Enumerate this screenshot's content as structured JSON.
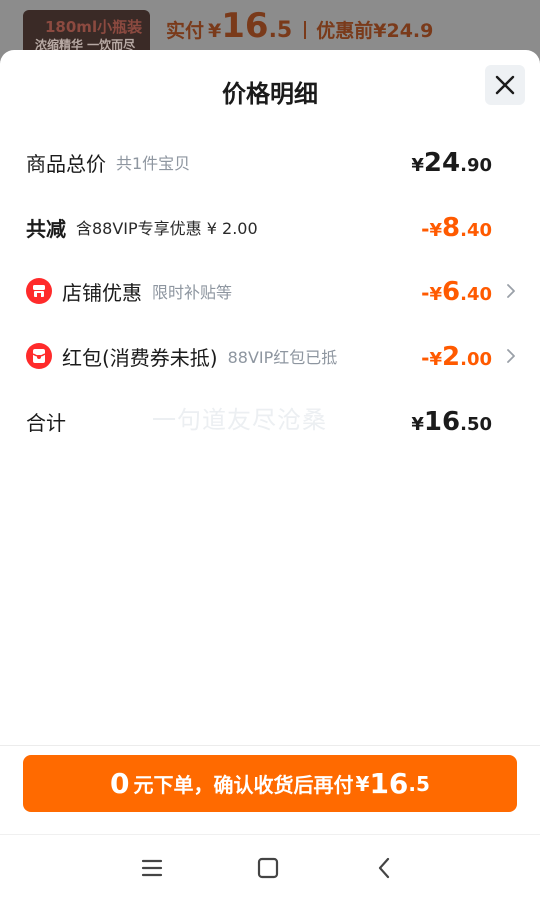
{
  "background": {
    "thumb_line1": "180ml小瓶装",
    "thumb_line2": "浓缩精华 一饮而尽",
    "paid_label": "实付",
    "paid_currency": "¥",
    "paid_int": "16",
    "paid_dec": ".5",
    "original_label": "优惠前",
    "original_price": "¥24.9"
  },
  "sheet": {
    "title": "价格明细",
    "close_icon": "close-icon"
  },
  "rows": [
    {
      "label": "商品总价",
      "sub": "共1件宝贝",
      "sign": "",
      "currency": "¥",
      "int": "24",
      "dec": ".90"
    },
    {
      "label": "共减",
      "sub": "含88VIP专享优惠 ¥ 2.00",
      "sign": "-",
      "currency": "¥",
      "int": "8",
      "dec": ".40"
    },
    {
      "label": "店铺优惠",
      "sub": "限时补贴等",
      "icon": "shop-icon",
      "sign": "-",
      "currency": "¥",
      "int": "6",
      "dec": ".40"
    },
    {
      "label": "红包(消费券未抵)",
      "sub": "88VIP红包已抵",
      "icon": "red-packet-icon",
      "sign": "-",
      "currency": "¥",
      "int": "2",
      "dec": ".00"
    },
    {
      "label": "合计",
      "sign": "",
      "currency": "¥",
      "int": "16",
      "dec": ".50"
    }
  ],
  "watermark": "一句道友尽沧桑",
  "pay_button": {
    "zero": "0",
    "text": "元下单，确认收货后再付",
    "currency": "¥",
    "int": "16",
    "dec": ".5"
  },
  "navbar": {
    "items": [
      "menu-icon",
      "home-icon",
      "back-icon"
    ]
  },
  "colors": {
    "accent": "#ff6a00",
    "discount": "#ff5a00",
    "badge_red": "#ff2b2b",
    "text": "#1b1b1b",
    "muted": "#8e96a0"
  }
}
